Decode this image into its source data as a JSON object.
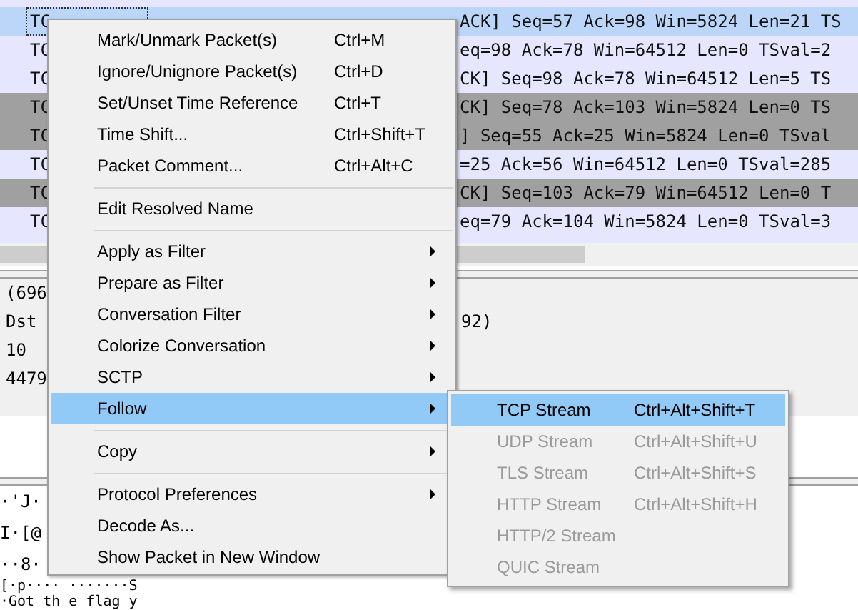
{
  "packet_list": {
    "rows": [
      {
        "protocol": "TC",
        "info": "ACK] Seq=57 Ack=98 Win=5824 Len=21 TS",
        "selected": true
      },
      {
        "protocol": "TC",
        "info": "eq=98 Ack=78 Win=64512 Len=0 TSval=2",
        "selected": false,
        "color": "#e7e6ff"
      },
      {
        "protocol": "TC",
        "info": "CK] Seq=98 Ack=78 Win=64512 Len=5 TS",
        "selected": false,
        "color": "#e7e6ff"
      },
      {
        "protocol": "TC",
        "info": "CK] Seq=78 Ack=103 Win=5824 Len=0 TS",
        "selected": false,
        "color": "#a0a0a0"
      },
      {
        "protocol": "TC",
        "info": "] Seq=55 Ack=25 Win=5824 Len=0 TSval",
        "selected": false,
        "color": "#a0a0a0"
      },
      {
        "protocol": "TC",
        "info": "=25 Ack=56 Win=64512 Len=0 TSval=285",
        "selected": false,
        "color": "#e7e6ff"
      },
      {
        "protocol": "TC",
        "info": "CK] Seq=103 Ack=79 Win=64512 Len=0 T",
        "selected": false,
        "color": "#a0a0a0"
      },
      {
        "protocol": "TC",
        "info": "eq=79 Ack=104 Win=5824 Len=0 TSval=3",
        "selected": false,
        "color": "#e7e6ff"
      }
    ]
  },
  "details_pane": {
    "lines": [
      {
        "text": "(696"
      },
      {
        "text": "Dst",
        "tail": "92)"
      },
      {
        "text": "10"
      },
      {
        "text": "4479"
      }
    ]
  },
  "bytes_pane": {
    "lines": [
      "·'J·",
      "I·[@",
      "··8·",
      "[·p···· ·······S",
      "·Got th e flag y"
    ]
  },
  "context_menu": {
    "groups": [
      [
        {
          "label": "Mark/Unmark Packet(s)",
          "shortcut": "Ctrl+M",
          "has_submenu": false,
          "selected": false
        },
        {
          "label": "Ignore/Unignore Packet(s)",
          "shortcut": "Ctrl+D",
          "has_submenu": false,
          "selected": false
        },
        {
          "label": "Set/Unset Time Reference",
          "shortcut": "Ctrl+T",
          "has_submenu": false,
          "selected": false
        },
        {
          "label": "Time Shift...",
          "shortcut": "Ctrl+Shift+T",
          "has_submenu": false,
          "selected": false
        },
        {
          "label": "Packet Comment...",
          "shortcut": "Ctrl+Alt+C",
          "has_submenu": false,
          "selected": false
        }
      ],
      [
        {
          "label": "Edit Resolved Name",
          "has_submenu": false,
          "selected": false
        }
      ],
      [
        {
          "label": "Apply as Filter",
          "has_submenu": true,
          "selected": false
        },
        {
          "label": "Prepare as Filter",
          "has_submenu": true,
          "selected": false
        },
        {
          "label": "Conversation Filter",
          "has_submenu": true,
          "selected": false
        },
        {
          "label": "Colorize Conversation",
          "has_submenu": true,
          "selected": false
        },
        {
          "label": "SCTP",
          "has_submenu": true,
          "selected": false
        },
        {
          "label": "Follow",
          "has_submenu": true,
          "selected": true
        }
      ],
      [
        {
          "label": "Copy",
          "has_submenu": true,
          "selected": false
        }
      ],
      [
        {
          "label": "Protocol Preferences",
          "has_submenu": true,
          "selected": false
        },
        {
          "label": "Decode As...",
          "has_submenu": false,
          "selected": false
        },
        {
          "label": "Show Packet in New Window",
          "has_submenu": false,
          "selected": false
        }
      ]
    ]
  },
  "submenu": {
    "items": [
      {
        "label": "TCP Stream",
        "shortcut": "Ctrl+Alt+Shift+T",
        "disabled": false,
        "selected": true
      },
      {
        "label": "UDP Stream",
        "shortcut": "Ctrl+Alt+Shift+U",
        "disabled": true,
        "selected": false
      },
      {
        "label": "TLS Stream",
        "shortcut": "Ctrl+Alt+Shift+S",
        "disabled": true,
        "selected": false
      },
      {
        "label": "HTTP Stream",
        "shortcut": "Ctrl+Alt+Shift+H",
        "disabled": true,
        "selected": false
      },
      {
        "label": "HTTP/2 Stream",
        "disabled": true,
        "selected": false
      },
      {
        "label": "QUIC Stream",
        "disabled": true,
        "selected": false
      }
    ]
  }
}
